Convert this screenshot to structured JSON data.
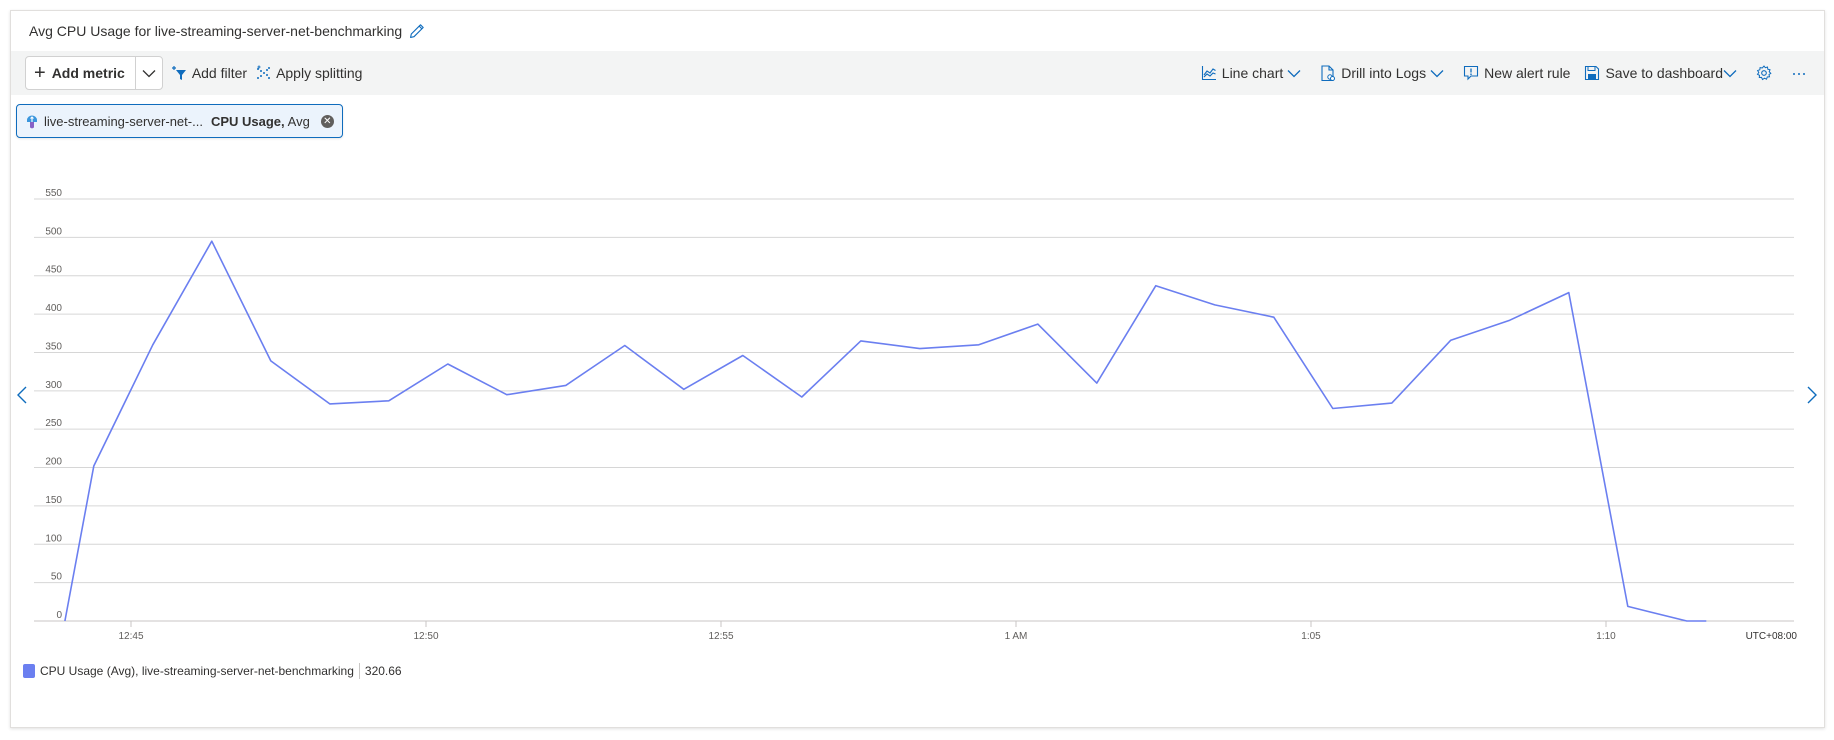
{
  "title": "Avg CPU Usage for live-streaming-server-net-benchmarking",
  "toolbar": {
    "add_metric": "Add metric",
    "add_filter": "Add filter",
    "apply_splitting": "Apply splitting",
    "line_chart": "Line chart",
    "drill_into_logs": "Drill into Logs",
    "new_alert_rule": "New alert rule",
    "save_to_dashboard": "Save to dashboard"
  },
  "metric_pill": {
    "resource": "live-streaming-server-net-...",
    "metric": "CPU Usage,",
    "aggregation": "Avg"
  },
  "legend": {
    "label": "CPU Usage (Avg), live-streaming-server-net-benchmarking",
    "value": "320.66",
    "color": "#6b7ff0"
  },
  "chart_data": {
    "type": "line",
    "title": "Avg CPU Usage for live-streaming-server-net-benchmarking",
    "xlabel": "",
    "ylabel": "",
    "timezone_label": "UTC+08:00",
    "ylim": [
      0,
      550
    ],
    "yticks": [
      0,
      50,
      100,
      150,
      200,
      250,
      300,
      350,
      400,
      450,
      500,
      550
    ],
    "xtick_labels": [
      "12:45",
      "12:50",
      "12:55",
      "1 AM",
      "1:05",
      "1:10"
    ],
    "xtick_minutes": [
      0,
      5,
      10,
      15,
      20,
      25
    ],
    "xlim_minutes": [
      -1.12,
      26.75
    ],
    "grid": true,
    "legend_position": "bottom-left",
    "series": [
      {
        "name": "CPU Usage (Avg), live-streaming-server-net-benchmarking",
        "color": "#6b7ff0",
        "x_minutes_from_1245": [
          -1.12,
          -0.63,
          0.37,
          1.37,
          2.37,
          3.37,
          4.37,
          5.37,
          6.37,
          7.37,
          8.37,
          9.37,
          10.37,
          11.37,
          12.37,
          13.37,
          14.37,
          15.37,
          16.37,
          17.37,
          18.37,
          19.37,
          20.37,
          21.37,
          22.37,
          23.37,
          24.37,
          25.37,
          26.37,
          26.7
        ],
        "values": [
          0,
          0,
          202,
          360,
          495,
          339,
          283,
          287,
          335,
          295,
          307,
          359,
          302,
          346,
          292,
          365,
          355,
          360,
          387,
          310,
          437,
          412,
          396,
          277,
          284,
          366,
          392,
          428,
          19,
          0,
          0
        ]
      }
    ]
  }
}
